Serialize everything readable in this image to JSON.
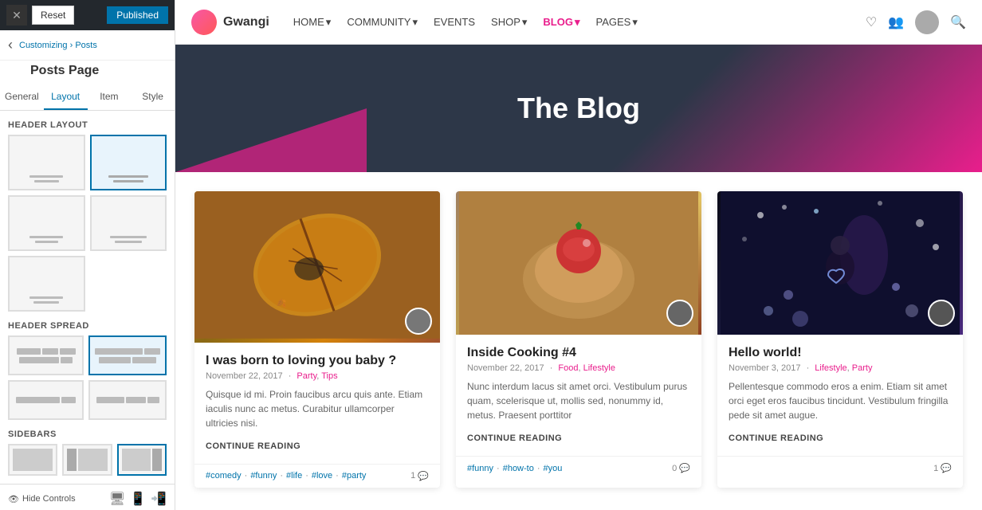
{
  "panel": {
    "close_label": "✕",
    "reset_label": "Reset",
    "published_label": "Published",
    "breadcrumb_root": "Customizing",
    "breadcrumb_sep": "›",
    "breadcrumb_page": "Posts",
    "page_title": "Posts Page",
    "back_arrow": "‹",
    "tabs": [
      "General",
      "Layout",
      "Item",
      "Style"
    ],
    "active_tab": "Layout",
    "header_layout_title": "Header Layout",
    "header_spread_title": "Header Spread",
    "sidebars_title": "Sidebars",
    "hide_controls": "Hide Controls",
    "layout_options": [
      {
        "id": "lo1",
        "selected": false
      },
      {
        "id": "lo2",
        "selected": true
      },
      {
        "id": "lo3",
        "selected": false
      },
      {
        "id": "lo4",
        "selected": false
      },
      {
        "id": "lo5",
        "selected": false
      }
    ],
    "spread_options": [
      {
        "id": "so1",
        "selected": false
      },
      {
        "id": "so2",
        "selected": true
      },
      {
        "id": "so3",
        "selected": false
      },
      {
        "id": "so4",
        "selected": false
      }
    ]
  },
  "navbar": {
    "logo_text": "Gwangi",
    "links": [
      {
        "label": "HOME",
        "active": false,
        "dropdown": true
      },
      {
        "label": "COMMUNITY",
        "active": false,
        "dropdown": true
      },
      {
        "label": "EVENTS",
        "active": false,
        "dropdown": false
      },
      {
        "label": "SHOP",
        "active": false,
        "dropdown": true
      },
      {
        "label": "BLOG",
        "active": true,
        "dropdown": true
      },
      {
        "label": "PAGES",
        "active": false,
        "dropdown": true
      }
    ]
  },
  "hero": {
    "title": "The Blog"
  },
  "blog": {
    "cards": [
      {
        "id": "card1",
        "title": "I was born to loving you baby ?",
        "date": "November 22, 2017",
        "tags": [
          "Party",
          "Tips"
        ],
        "excerpt": "Quisque id mi. Proin faucibus arcu quis ante. Etiam iaculis nunc ac metus. Curabitur ullamcorper ultricies nisi.",
        "read_more": "CONTINUE READING",
        "footer_tags": [
          "#comedy",
          "#funny",
          "#life",
          "#love",
          "#party"
        ],
        "comments": "1",
        "image_type": "leaf"
      },
      {
        "id": "card2",
        "title": "Inside Cooking #4",
        "date": "November 22, 2017",
        "tags": [
          "Food",
          "Lifestyle"
        ],
        "excerpt": "Nunc interdum lacus sit amet orci. Vestibulum purus quam, scelerisque ut, mollis sed, nonummy id, metus. Praesent porttitor",
        "read_more": "CONTINUE READING",
        "footer_tags": [
          "#funny",
          "#how-to",
          "#you"
        ],
        "comments": "0",
        "image_type": "food"
      },
      {
        "id": "card3",
        "title": "Hello world!",
        "date": "November 3, 2017",
        "tags": [
          "Lifestyle",
          "Party"
        ],
        "excerpt": "Pellentesque commodo eros a enim. Etiam sit amet orci eget eros faucibus tincidunt. Vestibulum fringilla pede sit amet augue.",
        "read_more": "CONTINUE READING",
        "footer_tags": [],
        "comments": "1",
        "image_type": "night"
      }
    ]
  }
}
